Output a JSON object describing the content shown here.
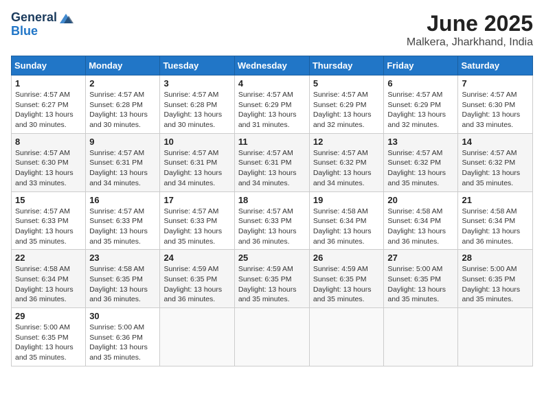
{
  "logo": {
    "line1": "General",
    "line2": "Blue"
  },
  "title": "June 2025",
  "location": "Malkera, Jharkhand, India",
  "weekdays": [
    "Sunday",
    "Monday",
    "Tuesday",
    "Wednesday",
    "Thursday",
    "Friday",
    "Saturday"
  ],
  "weeks": [
    [
      {
        "day": 1,
        "info": "Sunrise: 4:57 AM\nSunset: 6:27 PM\nDaylight: 13 hours\nand 30 minutes."
      },
      {
        "day": 2,
        "info": "Sunrise: 4:57 AM\nSunset: 6:28 PM\nDaylight: 13 hours\nand 30 minutes."
      },
      {
        "day": 3,
        "info": "Sunrise: 4:57 AM\nSunset: 6:28 PM\nDaylight: 13 hours\nand 30 minutes."
      },
      {
        "day": 4,
        "info": "Sunrise: 4:57 AM\nSunset: 6:29 PM\nDaylight: 13 hours\nand 31 minutes."
      },
      {
        "day": 5,
        "info": "Sunrise: 4:57 AM\nSunset: 6:29 PM\nDaylight: 13 hours\nand 32 minutes."
      },
      {
        "day": 6,
        "info": "Sunrise: 4:57 AM\nSunset: 6:29 PM\nDaylight: 13 hours\nand 32 minutes."
      },
      {
        "day": 7,
        "info": "Sunrise: 4:57 AM\nSunset: 6:30 PM\nDaylight: 13 hours\nand 33 minutes."
      }
    ],
    [
      {
        "day": 8,
        "info": "Sunrise: 4:57 AM\nSunset: 6:30 PM\nDaylight: 13 hours\nand 33 minutes."
      },
      {
        "day": 9,
        "info": "Sunrise: 4:57 AM\nSunset: 6:31 PM\nDaylight: 13 hours\nand 34 minutes."
      },
      {
        "day": 10,
        "info": "Sunrise: 4:57 AM\nSunset: 6:31 PM\nDaylight: 13 hours\nand 34 minutes."
      },
      {
        "day": 11,
        "info": "Sunrise: 4:57 AM\nSunset: 6:31 PM\nDaylight: 13 hours\nand 34 minutes."
      },
      {
        "day": 12,
        "info": "Sunrise: 4:57 AM\nSunset: 6:32 PM\nDaylight: 13 hours\nand 34 minutes."
      },
      {
        "day": 13,
        "info": "Sunrise: 4:57 AM\nSunset: 6:32 PM\nDaylight: 13 hours\nand 35 minutes."
      },
      {
        "day": 14,
        "info": "Sunrise: 4:57 AM\nSunset: 6:32 PM\nDaylight: 13 hours\nand 35 minutes."
      }
    ],
    [
      {
        "day": 15,
        "info": "Sunrise: 4:57 AM\nSunset: 6:33 PM\nDaylight: 13 hours\nand 35 minutes."
      },
      {
        "day": 16,
        "info": "Sunrise: 4:57 AM\nSunset: 6:33 PM\nDaylight: 13 hours\nand 35 minutes."
      },
      {
        "day": 17,
        "info": "Sunrise: 4:57 AM\nSunset: 6:33 PM\nDaylight: 13 hours\nand 35 minutes."
      },
      {
        "day": 18,
        "info": "Sunrise: 4:57 AM\nSunset: 6:33 PM\nDaylight: 13 hours\nand 36 minutes."
      },
      {
        "day": 19,
        "info": "Sunrise: 4:58 AM\nSunset: 6:34 PM\nDaylight: 13 hours\nand 36 minutes."
      },
      {
        "day": 20,
        "info": "Sunrise: 4:58 AM\nSunset: 6:34 PM\nDaylight: 13 hours\nand 36 minutes."
      },
      {
        "day": 21,
        "info": "Sunrise: 4:58 AM\nSunset: 6:34 PM\nDaylight: 13 hours\nand 36 minutes."
      }
    ],
    [
      {
        "day": 22,
        "info": "Sunrise: 4:58 AM\nSunset: 6:34 PM\nDaylight: 13 hours\nand 36 minutes."
      },
      {
        "day": 23,
        "info": "Sunrise: 4:58 AM\nSunset: 6:35 PM\nDaylight: 13 hours\nand 36 minutes."
      },
      {
        "day": 24,
        "info": "Sunrise: 4:59 AM\nSunset: 6:35 PM\nDaylight: 13 hours\nand 36 minutes."
      },
      {
        "day": 25,
        "info": "Sunrise: 4:59 AM\nSunset: 6:35 PM\nDaylight: 13 hours\nand 35 minutes."
      },
      {
        "day": 26,
        "info": "Sunrise: 4:59 AM\nSunset: 6:35 PM\nDaylight: 13 hours\nand 35 minutes."
      },
      {
        "day": 27,
        "info": "Sunrise: 5:00 AM\nSunset: 6:35 PM\nDaylight: 13 hours\nand 35 minutes."
      },
      {
        "day": 28,
        "info": "Sunrise: 5:00 AM\nSunset: 6:35 PM\nDaylight: 13 hours\nand 35 minutes."
      }
    ],
    [
      {
        "day": 29,
        "info": "Sunrise: 5:00 AM\nSunset: 6:35 PM\nDaylight: 13 hours\nand 35 minutes."
      },
      {
        "day": 30,
        "info": "Sunrise: 5:00 AM\nSunset: 6:36 PM\nDaylight: 13 hours\nand 35 minutes."
      },
      null,
      null,
      null,
      null,
      null
    ]
  ]
}
